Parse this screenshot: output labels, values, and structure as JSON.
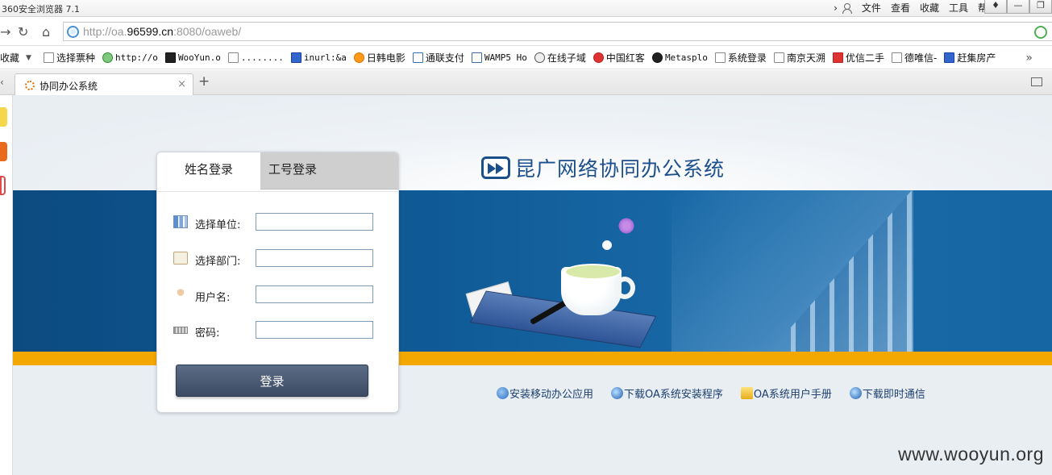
{
  "window": {
    "title": "360安全浏览器 7.1",
    "menus": [
      "文件",
      "查看",
      "收藏",
      "工具",
      "帮助"
    ]
  },
  "address": {
    "url_prefix": "http://oa.",
    "url_domain": "96599.cn",
    "url_suffix": ":8080/oaweb/"
  },
  "favorites": {
    "lead": "收藏",
    "items": [
      {
        "label": "选择票种",
        "icon": "page-icon",
        "style": ""
      },
      {
        "label": "http://o",
        "icon": "green-gear-icon",
        "style": "mono"
      },
      {
        "label": "WooYun.o",
        "icon": "wooyun-icon",
        "style": "mono"
      },
      {
        "label": "........",
        "icon": "page-icon",
        "style": "mono"
      },
      {
        "label": "inurl:&a",
        "icon": "paw-icon",
        "style": "mono"
      },
      {
        "label": "日韩电影",
        "icon": "play-icon",
        "style": ""
      },
      {
        "label": "通联支付",
        "icon": "tool-icon",
        "style": ""
      },
      {
        "label": "WAMP5 Ho",
        "icon": "tool-icon",
        "style": "mono"
      },
      {
        "label": "在线子域",
        "icon": "cat-icon",
        "style": ""
      },
      {
        "label": "中国红客",
        "icon": "red-badge-icon",
        "style": ""
      },
      {
        "label": "Metasplo",
        "icon": "metasploit-icon",
        "style": "mono"
      },
      {
        "label": "系统登录",
        "icon": "page-icon",
        "style": ""
      },
      {
        "label": "南京天溯",
        "icon": "page-icon",
        "style": ""
      },
      {
        "label": "优信二手",
        "icon": "red-bars-icon",
        "style": ""
      },
      {
        "label": "德唯信-",
        "icon": "page-icon",
        "style": ""
      },
      {
        "label": "赶集房产",
        "icon": "ganji-icon",
        "style": ""
      }
    ],
    "more": "»"
  },
  "tab": {
    "label": "协同办公系统"
  },
  "page": {
    "system_title": "昆广网络协同办公系统",
    "login_tabs": {
      "name_login": "姓名登录",
      "id_login": "工号登录"
    },
    "fields": {
      "unit_label": "选择单位:",
      "dept_label": "选择部门:",
      "user_label": "用户名:",
      "password_label": "密码:",
      "unit_value": "",
      "dept_value": "",
      "user_value": "",
      "password_value": ""
    },
    "login_button": "登录",
    "links": {
      "mobile_app": "安装移动办公应用",
      "download_oa": "下载OA系统安装程序",
      "user_manual": "OA系统用户手册",
      "download_im": "下载即时通信"
    },
    "watermark": "www.wooyun.org"
  },
  "colors": {
    "banner_blue": "#0f5a96",
    "accent_strip": "#f2a800",
    "title_blue": "#1c4f8c",
    "button_dark": "#3c4b63"
  }
}
